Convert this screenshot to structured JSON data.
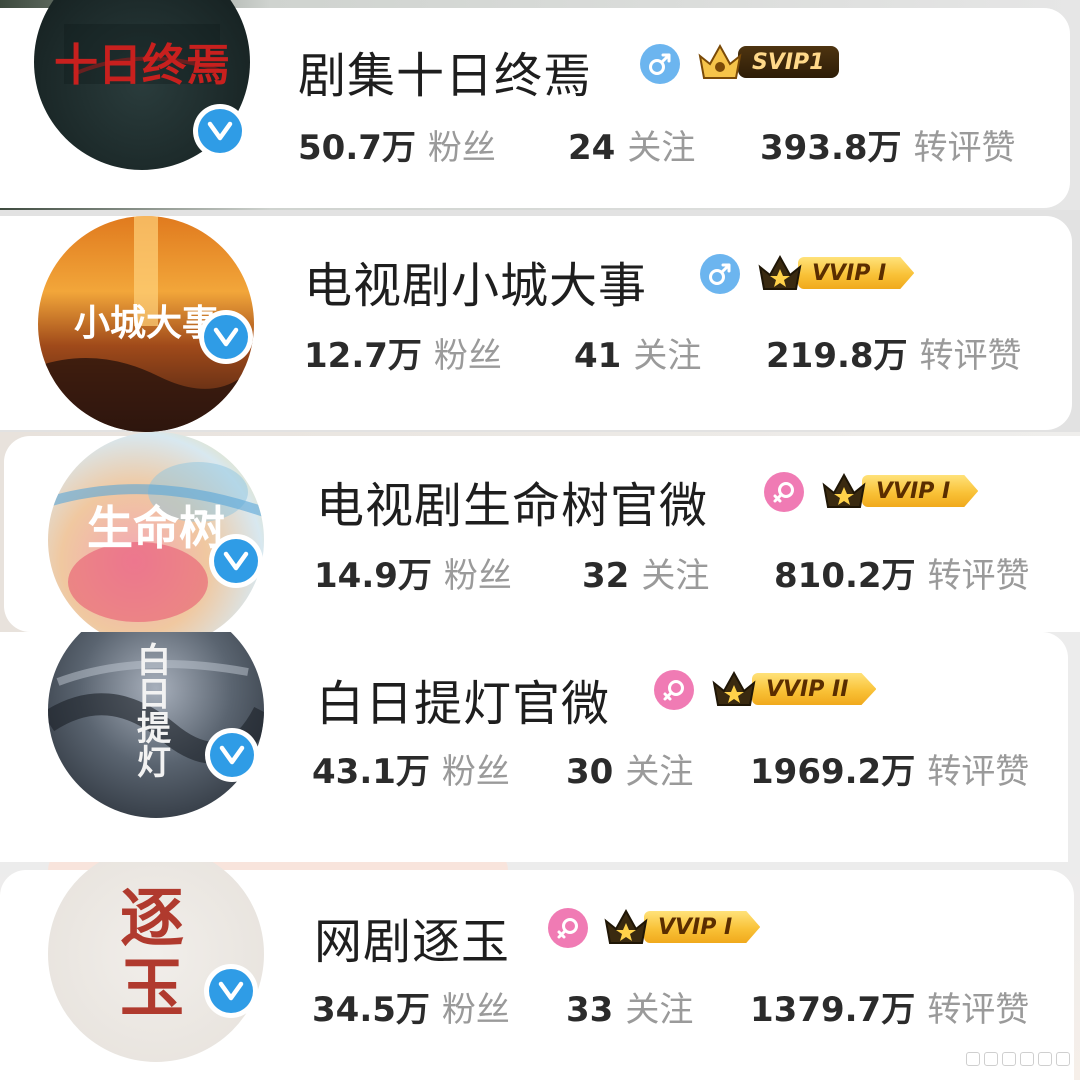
{
  "profiles": [
    {
      "name": "剧集十日终焉",
      "gender": "male",
      "vip": "SVIP1",
      "avatar_text": "十日终焉",
      "stats": [
        {
          "value": "50.7万",
          "label": "粉丝"
        },
        {
          "value": "24",
          "label": "关注"
        },
        {
          "value": "393.8万",
          "label": "转评赞"
        }
      ]
    },
    {
      "name": "电视剧小城大事",
      "gender": "male",
      "vip": "VVIP I",
      "avatar_text": "小城大事",
      "stats": [
        {
          "value": "12.7万",
          "label": "粉丝"
        },
        {
          "value": "41",
          "label": "关注"
        },
        {
          "value": "219.8万",
          "label": "转评赞"
        }
      ]
    },
    {
      "name": "电视剧生命树官微",
      "gender": "female",
      "vip": "VVIP I",
      "avatar_text": "生命树",
      "stats": [
        {
          "value": "14.9万",
          "label": "粉丝"
        },
        {
          "value": "32",
          "label": "关注"
        },
        {
          "value": "810.2万",
          "label": "转评赞"
        }
      ]
    },
    {
      "name": "白日提灯官微",
      "gender": "female",
      "vip": "VVIP II",
      "avatar_text": "白日提灯",
      "stats": [
        {
          "value": "43.1万",
          "label": "粉丝"
        },
        {
          "value": "30",
          "label": "关注"
        },
        {
          "value": "1969.2万",
          "label": "转评赞"
        }
      ]
    },
    {
      "name": "网剧逐玉",
      "gender": "female",
      "vip": "VVIP I",
      "avatar_text": "逐玉",
      "stats": [
        {
          "value": "34.5万",
          "label": "粉丝"
        },
        {
          "value": "33",
          "label": "关注"
        },
        {
          "value": "1379.7万",
          "label": "转评赞"
        }
      ]
    }
  ],
  "icons": {
    "verified": "verified-check-icon",
    "male": "male-symbol-icon",
    "female": "female-symbol-icon",
    "crown": "vip-crown-icon"
  },
  "colors": {
    "verified_blue": "#2f9ce6",
    "male_blue": "#6cb5ef",
    "female_pink": "#f07bb4",
    "vip_gold": "#f9c238",
    "svip_dark": "#2e1d07",
    "number_text": "#2b2b2b",
    "label_gray": "#9a9a9a"
  }
}
